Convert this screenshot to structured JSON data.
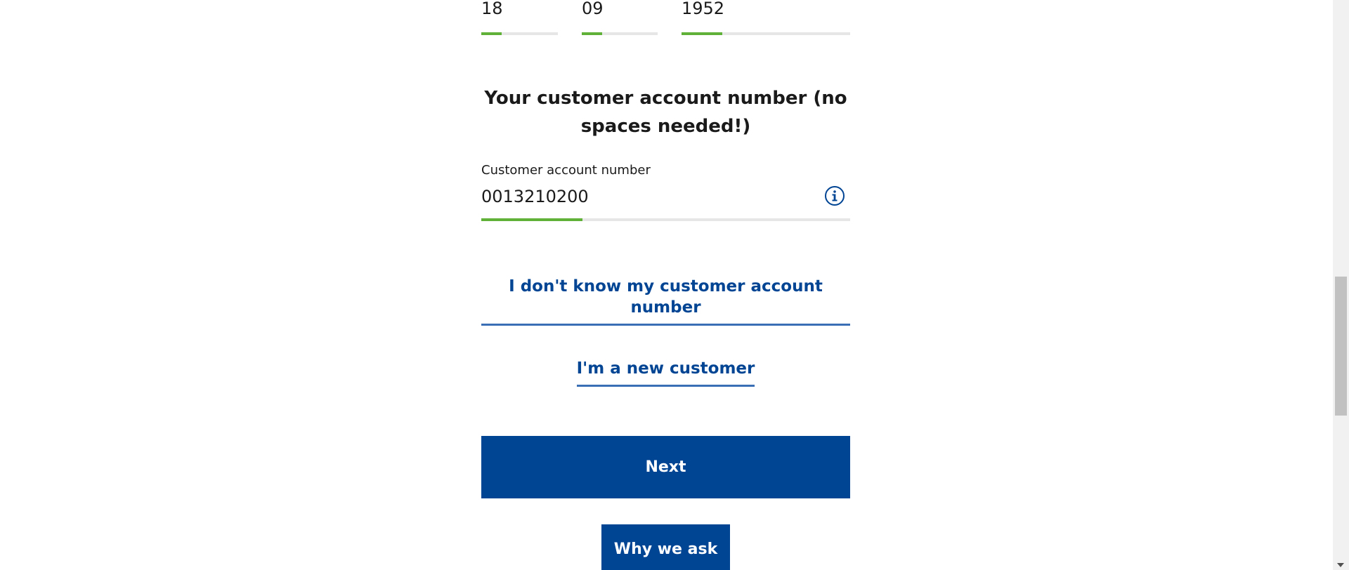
{
  "dob": {
    "day": {
      "value": "18",
      "progress": 0.27
    },
    "month": {
      "value": "09",
      "progress": 0.27
    },
    "year": {
      "value": "1952",
      "progress": 0.24
    }
  },
  "account": {
    "heading": "Your customer account number (no spaces needed!)",
    "label": "Customer account number",
    "value": "0013210200",
    "progress": 0.275,
    "info_icon": "info-icon"
  },
  "links": {
    "dont_know": "I don't know my customer account number",
    "new_customer": "I'm a new customer"
  },
  "buttons": {
    "next": "Next",
    "why_we_ask": "Why we ask"
  },
  "colors": {
    "primary": "#004494",
    "link": "#004494",
    "progress_green": "#5fb137",
    "track": "#e6e6e6"
  }
}
